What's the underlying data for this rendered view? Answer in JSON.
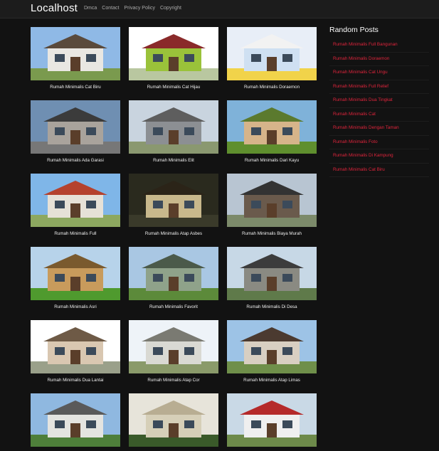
{
  "header": {
    "brand": "Localhost",
    "nav": [
      "Dmca",
      "Contact",
      "Privacy Policy",
      "Copyright"
    ]
  },
  "posts": [
    {
      "title": "Rumah Minimalis Cat Biru",
      "sky": "#8fb9e6",
      "wall": "#e9e7e2",
      "roof": "#5a4a3c",
      "ground": "#7a9a4e"
    },
    {
      "title": "Rumah Minimalis Cat Hijau",
      "sky": "#ffffff",
      "wall": "#9ac23a",
      "roof": "#8a2a2a",
      "ground": "#b9c7a0"
    },
    {
      "title": "Rumah Minimalis Doraemon",
      "sky": "#e8eef7",
      "wall": "#cfe0f2",
      "roof": "#f2f2f2",
      "ground": "#f1d34a"
    },
    {
      "title": "Rumah Minimalis Ada Garasi",
      "sky": "#6f8fb2",
      "wall": "#a9a39c",
      "roof": "#3b3b3b",
      "ground": "#777"
    },
    {
      "title": "Rumah Minimalis Elit",
      "sky": "#c9d4df",
      "wall": "#8c8f93",
      "roof": "#5e5e5e",
      "ground": "#8a9870"
    },
    {
      "title": "Rumah Minimalis Dari Kayu",
      "sky": "#7fb2d9",
      "wall": "#d6b48a",
      "roof": "#5b7a2e",
      "ground": "#5f8f2e"
    },
    {
      "title": "Rumah Minimalis Full",
      "sky": "#7fb6e8",
      "wall": "#e6e1d7",
      "roof": "#b5422e",
      "ground": "#8da860"
    },
    {
      "title": "Rumah Minimalis Atap Asbes",
      "sky": "#2a2a1e",
      "wall": "#c8b88c",
      "roof": "#2b2418",
      "ground": "#3a3a2a"
    },
    {
      "title": "Rumah Minimalis Biaya Murah",
      "sky": "#b8c5d2",
      "wall": "#6a5a4c",
      "roof": "#333",
      "ground": "#7c8a6a"
    },
    {
      "title": "Rumah Minimalis Asri",
      "sky": "#b7d3ea",
      "wall": "#c89b5c",
      "roof": "#7a5a2e",
      "ground": "#4f9a2e"
    },
    {
      "title": "Rumah Minimalis Favorit",
      "sky": "#a9c7e3",
      "wall": "#8fa28a",
      "roof": "#4b5a4a",
      "ground": "#5c8a3a"
    },
    {
      "title": "Rumah Minimalis Di Desa",
      "sky": "#c7d8e6",
      "wall": "#8a8a82",
      "roof": "#3c3c3c",
      "ground": "#5f7a4a"
    },
    {
      "title": "Rumah Minimalis Dua Lantai",
      "sky": "#ffffff",
      "wall": "#d9c7b1",
      "roof": "#6e5a46",
      "ground": "#9aa08a"
    },
    {
      "title": "Rumah Minimalis Atap Cor",
      "sky": "#eef3f8",
      "wall": "#d9d9d3",
      "roof": "#7a7a72",
      "ground": "#8a9a6a"
    },
    {
      "title": "Rumah Minimalis Atap Limas",
      "sky": "#9dc3e6",
      "wall": "#d8cfc2",
      "roof": "#4b3a30",
      "ground": "#6f8f4a"
    },
    {
      "title": "",
      "sky": "#8fb8e0",
      "wall": "#e4e4e0",
      "roof": "#5a5a5a",
      "ground": "#4e7f3a"
    },
    {
      "title": "",
      "sky": "#e7e4da",
      "wall": "#d6cfb8",
      "roof": "#b8ad92",
      "ground": "#3a5a2a"
    },
    {
      "title": "",
      "sky": "#c9d9e6",
      "wall": "#efefef",
      "roof": "#b52a2a",
      "ground": "#6d8a4a"
    }
  ],
  "sidebar": {
    "title": "Random Posts",
    "items": [
      "Rumah Minimalis Full Bangunan",
      "Rumah Minimalis Doraemon",
      "Rumah Minimalis Cat Ungu",
      "Rumah Minimalis Full Relief",
      "Rumah Minimalis Dua Tingkat",
      "Rumah Minimalis Cat",
      "Rumah Minimalis Dengan Taman",
      "Rumah Minimalis Foto",
      "Rumah Minimalis Di Kampung",
      "Rumah Minimalis Cat Biru"
    ]
  }
}
